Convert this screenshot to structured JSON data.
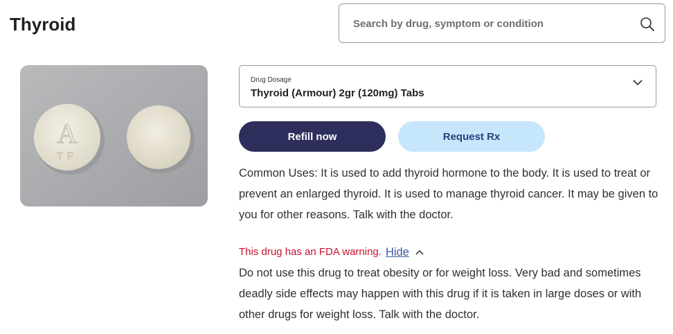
{
  "header": {
    "title": "Thyroid"
  },
  "search": {
    "placeholder": "Search by drug, symptom or condition",
    "icon": "search-icon"
  },
  "pill_image": {
    "imprint_top": "A",
    "imprint_bottom": "TF"
  },
  "dosage": {
    "label": "Drug Dosage",
    "value": "Thyroid (Armour) 2gr (120mg) Tabs",
    "icon": "chevron-down-icon"
  },
  "actions": {
    "refill_label": "Refill now",
    "request_label": "Request Rx"
  },
  "common_uses": {
    "text": "Common Uses: It is used to add thyroid hormone to the body. It is used to treat or prevent an enlarged thyroid. It is used to manage thyroid cancer. It may be given to you for other reasons. Talk with the doctor."
  },
  "fda": {
    "warning_text": "This drug has an FDA warning.",
    "toggle_label": "Hide",
    "detail_text": "Do not use this drug to treat obesity or for weight loss. Very bad and sometimes deadly side effects may happen with this drug if it is taken in large doses or with other drugs for weight loss. Talk with the doctor."
  },
  "colors": {
    "refill_button": "#2e2e5c",
    "request_button": "#c5e6fb",
    "warning": "#c8102e",
    "link": "#3a5aa0"
  }
}
